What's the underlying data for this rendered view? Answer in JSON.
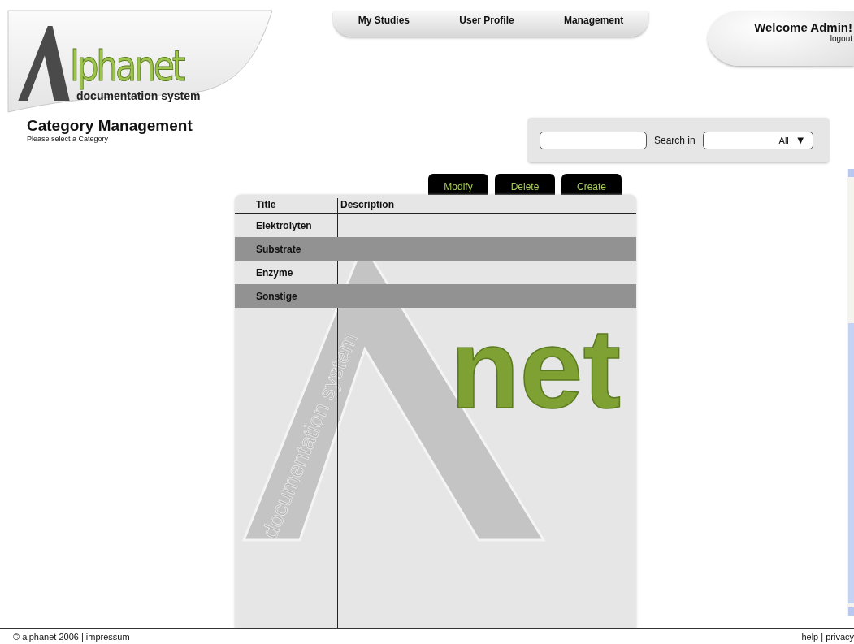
{
  "logo": {
    "word": "lphanet",
    "tagline": "documentation system"
  },
  "nav": [
    {
      "label": "My Studies"
    },
    {
      "label": "User Profile"
    },
    {
      "label": "Management"
    }
  ],
  "welcome": {
    "greeting": "Welcome Admin!",
    "logout": "logout"
  },
  "page": {
    "title": "Category Management",
    "subtitle": "Please select a Category"
  },
  "search": {
    "label": "Search in",
    "scope": "All",
    "arrow": "▼"
  },
  "actions": [
    {
      "label": "Modify"
    },
    {
      "label": "Delete"
    },
    {
      "label": "Create"
    }
  ],
  "table": {
    "columns": [
      "Title",
      "Description"
    ],
    "rows": [
      {
        "title": "Elektrolyten",
        "shaded": false
      },
      {
        "title": "Substrate",
        "shaded": true
      },
      {
        "title": "Enzyme",
        "shaded": false
      },
      {
        "title": "Sonstige",
        "shaded": true
      }
    ]
  },
  "watermark": {
    "word": "net",
    "tagline": "documentation system"
  },
  "footer": {
    "left": "© alphanet 2006 | impressum",
    "right": "help | privacy"
  }
}
